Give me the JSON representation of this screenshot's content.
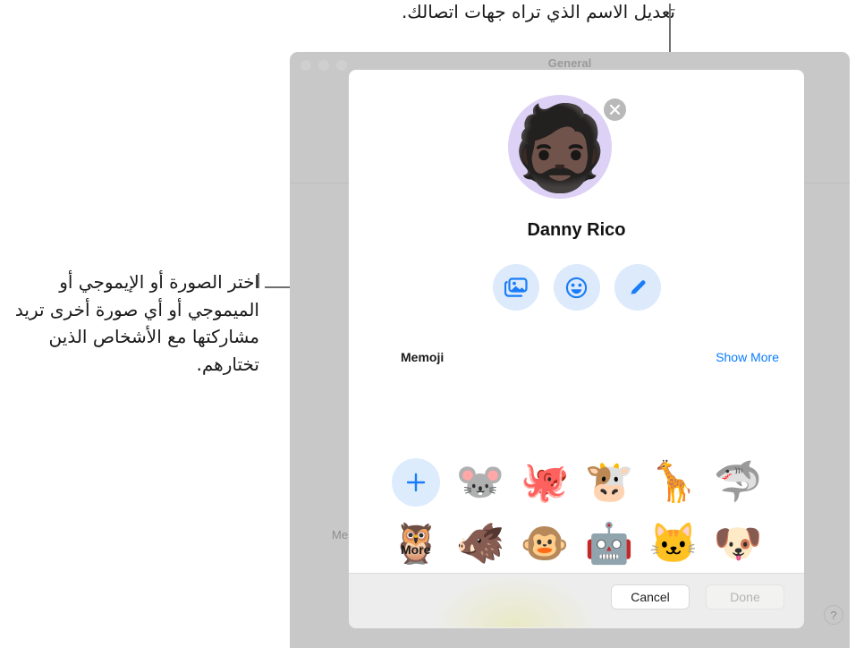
{
  "callouts": {
    "top": "تعديل الاسم الذي تراه جهات اتصالك.",
    "left": "اختر الصورة أو الإيموجي أو الميموجي أو أي صورة أخرى تريد مشاركتها مع الأشخاص الذين تختارهم."
  },
  "window": {
    "title": "General",
    "background_label": "Me"
  },
  "sheet": {
    "person_name": "Danny Rico",
    "avatar_emoji": "🧔🏿",
    "avatar_background_color": "#ddd1f5",
    "remove_avatar_label": "×",
    "actions": [
      {
        "name": "photos",
        "label": "Photos"
      },
      {
        "name": "emoji",
        "label": "Emoji"
      },
      {
        "name": "edit",
        "label": "Edit"
      }
    ],
    "memoji": {
      "title": "Memoji",
      "show_more": "Show More",
      "add_label": "+",
      "items_row1": [
        {
          "name": "mouse",
          "glyph": "🐭"
        },
        {
          "name": "octopus",
          "glyph": "🐙"
        },
        {
          "name": "cow",
          "glyph": "🐮"
        },
        {
          "name": "giraffe",
          "glyph": "🦒"
        },
        {
          "name": "shark",
          "glyph": "🦈"
        }
      ],
      "items_row2": [
        {
          "name": "owl",
          "glyph": "🦉"
        },
        {
          "name": "boar",
          "glyph": "🐗"
        },
        {
          "name": "monkey",
          "glyph": "🐵"
        },
        {
          "name": "robot",
          "glyph": "🤖"
        },
        {
          "name": "cat",
          "glyph": "🐱"
        },
        {
          "name": "dog",
          "glyph": "🐶"
        }
      ]
    },
    "more_title": "More",
    "buttons": {
      "cancel": "Cancel",
      "done": "Done"
    }
  },
  "help": {
    "label": "?"
  },
  "colors": {
    "accent_blue": "#0a7dff",
    "action_bg": "#dceafc",
    "window_chrome": "#c8c8c8",
    "footer": "#ededed"
  }
}
